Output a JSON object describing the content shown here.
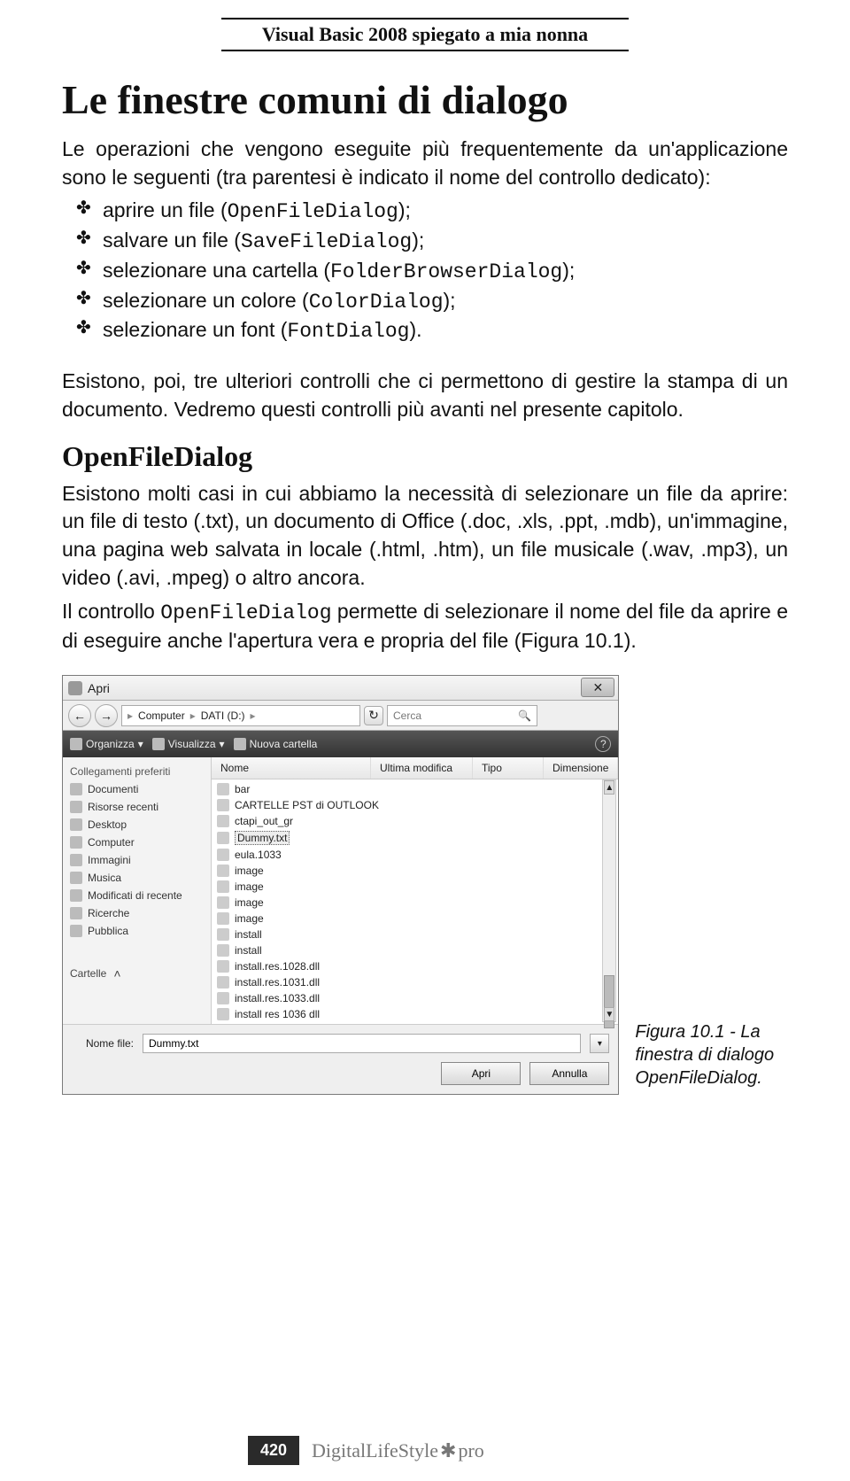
{
  "header": {
    "title": "Visual Basic 2008 spiegato a mia nonna"
  },
  "section": {
    "title": "Le finestre comuni di dialogo",
    "intro": "Le operazioni che vengono eseguite più frequentemente da un'applicazione sono le seguenti (tra parentesi è indicato il nome del controllo dedicato):",
    "bullets": [
      {
        "pre": "aprire un file (",
        "code": "OpenFileDialog",
        "post": ");"
      },
      {
        "pre": "salvare un file (",
        "code": "SaveFileDialog",
        "post": ");"
      },
      {
        "pre": "selezionare una cartella (",
        "code": "FolderBrowserDialog",
        "post": ");"
      },
      {
        "pre": "selezionare un colore (",
        "code": "ColorDialog",
        "post": ");"
      },
      {
        "pre": "selezionare un font (",
        "code": "FontDialog",
        "post": ")."
      }
    ],
    "after_bullets": "Esistono, poi, tre ulteriori controlli che ci permettono di gestire la stampa di un documento. Vedremo questi controlli più avanti nel presente capitolo."
  },
  "subsection": {
    "title": "OpenFileDialog",
    "para1": "Esistono molti casi in cui abbiamo la necessità di selezionare un file da aprire: un file di testo (.txt), un documento di Office (.doc, .xls, .ppt, .mdb), un'immagine, una pagina web salvata in locale (.html, .htm), un file musicale (.wav, .mp3), un video (.avi, .mpeg) o altro ancora.",
    "para2_pre": "Il controllo ",
    "para2_code": "OpenFileDialog",
    "para2_post": " permette di selezionare il nome del file da aprire e di eseguire anche l'apertura vera e propria del file (Figura 10.1)."
  },
  "dialog": {
    "title": "Apri",
    "path_segments": [
      "Computer",
      "DATI (D:)"
    ],
    "refresh": "↻",
    "search_placeholder": "Cerca",
    "toolbar": {
      "organize": "Organizza",
      "views": "Visualizza",
      "newfolder": "Nuova cartella"
    },
    "sidebar": {
      "heading": "Collegamenti preferiti",
      "items": [
        "Documenti",
        "Risorse recenti",
        "Desktop",
        "Computer",
        "Immagini",
        "Musica",
        "Modificati di recente",
        "Ricerche",
        "Pubblica"
      ],
      "folders_label": "Cartelle"
    },
    "columns": {
      "name": "Nome",
      "modified": "Ultima modifica",
      "type": "Tipo",
      "size": "Dimensione"
    },
    "files": [
      {
        "name": "bar",
        "selected": false
      },
      {
        "name": "CARTELLE PST di OUTLOOK",
        "selected": false
      },
      {
        "name": "ctapi_out_gr",
        "selected": false
      },
      {
        "name": "Dummy.txt",
        "selected": true
      },
      {
        "name": "eula.1033",
        "selected": false
      },
      {
        "name": "image",
        "selected": false
      },
      {
        "name": "image",
        "selected": false
      },
      {
        "name": "image",
        "selected": false
      },
      {
        "name": "image",
        "selected": false
      },
      {
        "name": "install",
        "selected": false
      },
      {
        "name": "install",
        "selected": false
      },
      {
        "name": "install.res.1028.dll",
        "selected": false
      },
      {
        "name": "install.res.1031.dll",
        "selected": false
      },
      {
        "name": "install.res.1033.dll",
        "selected": false
      },
      {
        "name": "install res 1036 dll",
        "selected": false
      }
    ],
    "filename_label": "Nome file:",
    "filename_value": "Dummy.txt",
    "open_btn": "Apri",
    "cancel_btn": "Annulla"
  },
  "caption": "Figura 10.1 - La finestra di dialogo OpenFileDialog.",
  "footer": {
    "page": "420",
    "brand_a": "DigitalLifeStyle",
    "brand_b": "pro"
  }
}
